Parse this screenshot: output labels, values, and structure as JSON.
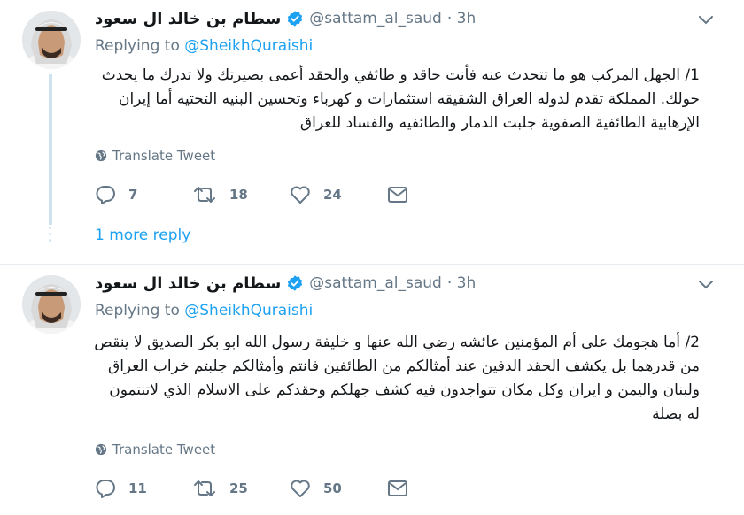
{
  "colors": {
    "accent": "#1da1f2",
    "muted": "#657786",
    "text": "#14171a",
    "thread_line": "#cfe3ee",
    "divider": "#e6ecf0"
  },
  "tweets": [
    {
      "name": "سطام بن خالد ال سعود",
      "handle": "@sattam_al_saud",
      "time": "· 3h",
      "replying_prefix": "Replying to",
      "replying_to": "@SheikhQuraishi",
      "text": "1/ الجهل المركب هو ما تتحدث عنه فأنت حاقد و طائفي والحقد أعمى بصيرتك ولا تدرك ما يحدث حولك. المملكة تقدم لدوله العراق الشقيقه استثمارات و كهرباء وتحسين البنيه التحتيه أما إيران الإرهابية الطائفية الصفوية جلبت الدمار والطائفيه والفساد للعراق",
      "translate_label": "Translate Tweet",
      "replies": "7",
      "retweets": "18",
      "likes": "24",
      "more_replies": "1 more reply"
    },
    {
      "name": "سطام بن خالد ال سعود",
      "handle": "@sattam_al_saud",
      "time": "· 3h",
      "replying_prefix": "Replying to",
      "replying_to": "@SheikhQuraishi",
      "text": "2/ أما هجومك على أم المؤمنين عائشه رضي الله عنها و خليفة رسول الله ابو بكر الصديق لا ينقص من قدرهما بل يكشف الحقد الدفين عند أمثالكم من الطائفين فانتم وأمثالكم جلبتم خراب العراق ولبنان واليمن و ايران وكل مكان تتواجدون فيه كشف جهلكم وحقدكم على الاسلام  الذي لاتنتمون له بصلة",
      "translate_label": "Translate Tweet",
      "replies": "11",
      "retweets": "25",
      "likes": "50"
    }
  ]
}
